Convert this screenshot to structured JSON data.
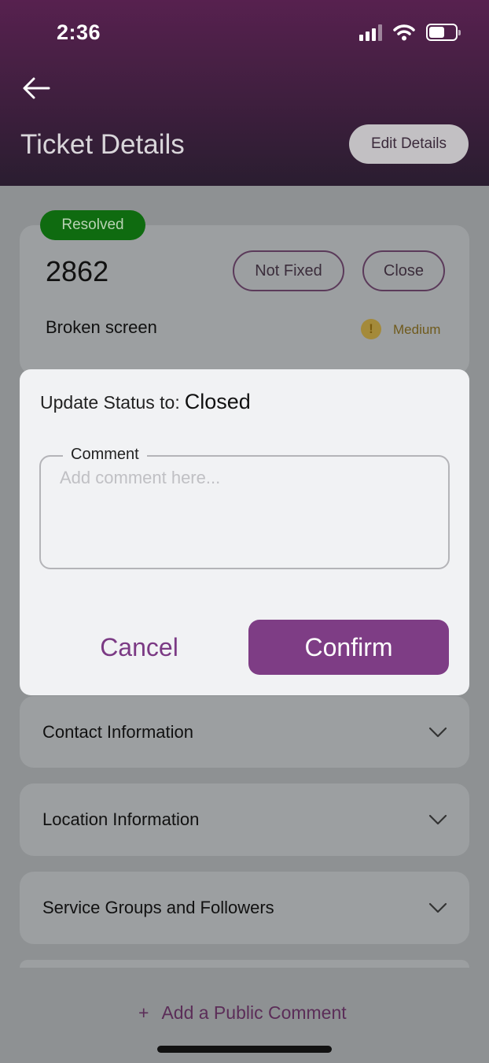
{
  "status_bar": {
    "time": "2:36"
  },
  "header": {
    "title": "Ticket Details",
    "edit_label": "Edit Details"
  },
  "ticket": {
    "status_badge": "Resolved",
    "number": "2862",
    "not_fixed_label": "Not Fixed",
    "close_label": "Close",
    "description": "Broken screen",
    "priority_icon": "!",
    "priority": "Medium"
  },
  "dialog": {
    "heading_prefix": "Update Status to:",
    "heading_status": "Closed",
    "comment_label": "Comment",
    "comment_placeholder": "Add comment here...",
    "comment_value": "",
    "cancel_label": "Cancel",
    "confirm_label": "Confirm"
  },
  "sections": [
    {
      "title": "Contact Information"
    },
    {
      "title": "Location Information"
    },
    {
      "title": "Service Groups and Followers"
    }
  ],
  "footer": {
    "add_comment_icon": "+",
    "add_comment_label": "Add a Public Comment"
  },
  "colors": {
    "brand_purple": "#7e3d85",
    "resolved_green": "#0f6b10",
    "priority_medium": "#a48a3a"
  }
}
